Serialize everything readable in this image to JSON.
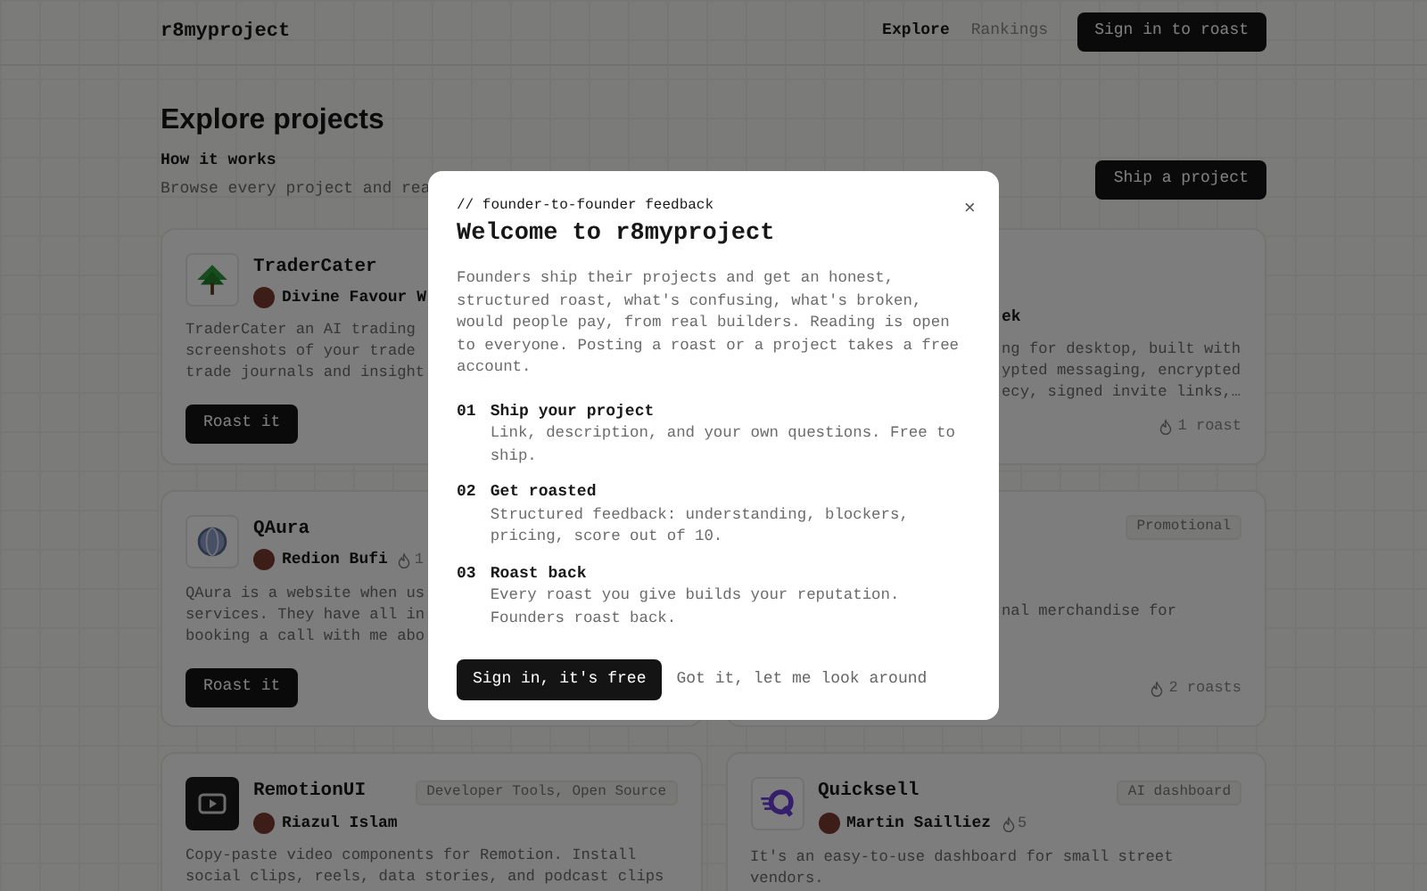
{
  "header": {
    "logo": "r8myproject",
    "nav": [
      {
        "label": "Explore",
        "selected": true
      },
      {
        "label": "Rankings",
        "selected": false
      }
    ],
    "sign_in": "Sign in to roast"
  },
  "page": {
    "title": "Explore projects",
    "subtitle": "How it works",
    "intro": "Browse every project and rea",
    "ship_button": "Ship a project"
  },
  "projects": [
    {
      "kind": "left",
      "name": "TraderCater",
      "author": "Divine Favour W",
      "description": [
        "TraderCater an AI trading",
        "screenshots of your trade",
        "trade journals and insight"
      ],
      "action": "Roast it"
    },
    {
      "kind": "right",
      "author": "ek",
      "description": [
        "ng for desktop, built with",
        "ypted messaging, encrypted",
        "ecy, signed invite links,…"
      ],
      "roasts": "1 roast"
    },
    {
      "kind": "left",
      "name": "QAura",
      "author": "Redion Bufi",
      "count": "1",
      "description": [
        "QAura is a website when us",
        "services. They have all in",
        "booking a call with me abo"
      ],
      "action": "Roast it"
    },
    {
      "kind": "right",
      "tag": "Promotional",
      "description": [
        "nal merchandise for"
      ],
      "roasts": "2 roasts"
    },
    {
      "kind": "full",
      "name": "RemotionUI",
      "tag": "Developer Tools, Open Source",
      "author": "Riazul Islam",
      "description": [
        "Copy-paste video components for Remotion. Install",
        "social clips, reels, data stories, and podcast clips"
      ]
    },
    {
      "kind": "full",
      "name": "Quicksell",
      "tag": "AI dashboard",
      "author": "Martin Sailliez",
      "count": "5",
      "description": [
        "It's an easy-to-use dashboard for small street",
        "vendors."
      ]
    }
  ],
  "modal": {
    "eyebrow": "// founder-to-founder feedback",
    "title": "Welcome to r8myproject",
    "close": "×",
    "text": "Founders ship their projects and get an honest, structured roast, what's confusing, what's broken, would people pay, from real builders. Reading is open to everyone. Posting a roast or a project takes a free account.",
    "steps": [
      {
        "number": "01",
        "title": "Ship your project",
        "text": "Link, description, and your own questions. Free to ship."
      },
      {
        "number": "02",
        "title": "Get roasted",
        "text": "Structured feedback: understanding, blockers, pricing, score out of 10."
      },
      {
        "number": "03",
        "title": "Roast back",
        "text": "Every roast you give builds your reputation. Founders roast back."
      }
    ],
    "primary": "Sign in, it's free",
    "secondary": "Got it, let me look around"
  }
}
